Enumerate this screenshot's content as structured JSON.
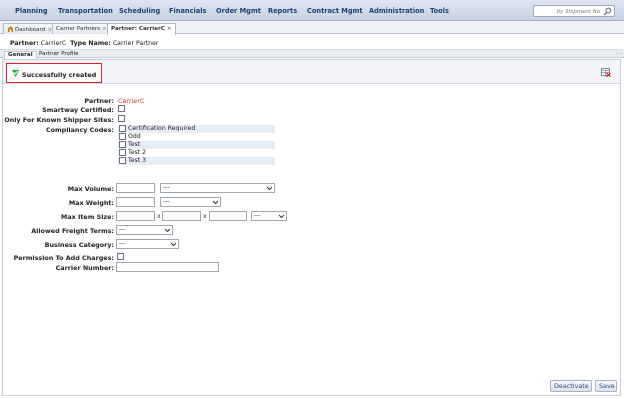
{
  "nav": {
    "items": [
      "Planning",
      "Transportation",
      "Scheduling",
      "Financials",
      "Order Mgmt",
      "Reports",
      "Contract Mgmt",
      "Administration",
      "Tools"
    ],
    "search_placeholder": "by Shipment No"
  },
  "tabs": [
    {
      "label": "Dashboard",
      "close": "×"
    },
    {
      "label": "Carrier Partners",
      "close": "×"
    },
    {
      "label": "Partner: CarrierC",
      "close": "×"
    }
  ],
  "header": {
    "partner_label": "Partner:",
    "partner_value": "CarrierC",
    "type_label": "Type Name:",
    "type_value": "Carrier Partner"
  },
  "subtabs": [
    "General",
    "Partner Profile"
  ],
  "subtab_scroll": "‹ ›",
  "message": "Successfully created",
  "form": {
    "partner_label": "Partner:",
    "partner_value": "CarrierC",
    "smartway_label": "Smartway Certified:",
    "known_shipper_label": "Only For Known Shipper Sites:",
    "compliancy_label": "Compliancy Codes:",
    "compliancy_codes": [
      "Certification Required",
      "Odd",
      "Test",
      "Test 2",
      "Test 3"
    ],
    "max_volume_label": "Max Volume:",
    "max_volume_unit": "---",
    "max_weight_label": "Max Weight:",
    "max_weight_unit": "---",
    "max_item_size_label": "Max Item Size:",
    "size_separator": "x",
    "max_item_unit": "---",
    "freight_terms_label": "Allowed Freight Terms:",
    "freight_terms_value": "---",
    "business_category_label": "Business Category:",
    "business_category_value": "---",
    "permission_label": "Permission To Add Charges:",
    "carrier_number_label": "Carrier Number:"
  },
  "buttons": {
    "deactivate": "Deactivate",
    "save": "Save"
  },
  "colors": {
    "nav_text": "#1f3f73",
    "success_border": "#d9262c",
    "partner_value": "#c0392b",
    "check_icon": "#3aa63a"
  },
  "icons": {
    "search": "magnifier-icon",
    "home": "home-icon",
    "success": "check-shield-icon",
    "grid": "grid-delete-icon"
  }
}
